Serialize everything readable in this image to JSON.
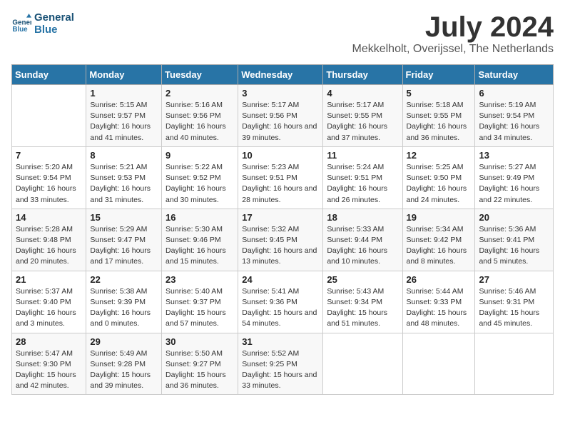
{
  "logo": {
    "text_general": "General",
    "text_blue": "Blue"
  },
  "title": "July 2024",
  "location": "Mekkelholt, Overijssel, The Netherlands",
  "headers": [
    "Sunday",
    "Monday",
    "Tuesday",
    "Wednesday",
    "Thursday",
    "Friday",
    "Saturday"
  ],
  "weeks": [
    [
      {
        "day": "",
        "sunrise": "",
        "sunset": "",
        "daylight": ""
      },
      {
        "day": "1",
        "sunrise": "Sunrise: 5:15 AM",
        "sunset": "Sunset: 9:57 PM",
        "daylight": "Daylight: 16 hours and 41 minutes."
      },
      {
        "day": "2",
        "sunrise": "Sunrise: 5:16 AM",
        "sunset": "Sunset: 9:56 PM",
        "daylight": "Daylight: 16 hours and 40 minutes."
      },
      {
        "day": "3",
        "sunrise": "Sunrise: 5:17 AM",
        "sunset": "Sunset: 9:56 PM",
        "daylight": "Daylight: 16 hours and 39 minutes."
      },
      {
        "day": "4",
        "sunrise": "Sunrise: 5:17 AM",
        "sunset": "Sunset: 9:55 PM",
        "daylight": "Daylight: 16 hours and 37 minutes."
      },
      {
        "day": "5",
        "sunrise": "Sunrise: 5:18 AM",
        "sunset": "Sunset: 9:55 PM",
        "daylight": "Daylight: 16 hours and 36 minutes."
      },
      {
        "day": "6",
        "sunrise": "Sunrise: 5:19 AM",
        "sunset": "Sunset: 9:54 PM",
        "daylight": "Daylight: 16 hours and 34 minutes."
      }
    ],
    [
      {
        "day": "7",
        "sunrise": "Sunrise: 5:20 AM",
        "sunset": "Sunset: 9:54 PM",
        "daylight": "Daylight: 16 hours and 33 minutes."
      },
      {
        "day": "8",
        "sunrise": "Sunrise: 5:21 AM",
        "sunset": "Sunset: 9:53 PM",
        "daylight": "Daylight: 16 hours and 31 minutes."
      },
      {
        "day": "9",
        "sunrise": "Sunrise: 5:22 AM",
        "sunset": "Sunset: 9:52 PM",
        "daylight": "Daylight: 16 hours and 30 minutes."
      },
      {
        "day": "10",
        "sunrise": "Sunrise: 5:23 AM",
        "sunset": "Sunset: 9:51 PM",
        "daylight": "Daylight: 16 hours and 28 minutes."
      },
      {
        "day": "11",
        "sunrise": "Sunrise: 5:24 AM",
        "sunset": "Sunset: 9:51 PM",
        "daylight": "Daylight: 16 hours and 26 minutes."
      },
      {
        "day": "12",
        "sunrise": "Sunrise: 5:25 AM",
        "sunset": "Sunset: 9:50 PM",
        "daylight": "Daylight: 16 hours and 24 minutes."
      },
      {
        "day": "13",
        "sunrise": "Sunrise: 5:27 AM",
        "sunset": "Sunset: 9:49 PM",
        "daylight": "Daylight: 16 hours and 22 minutes."
      }
    ],
    [
      {
        "day": "14",
        "sunrise": "Sunrise: 5:28 AM",
        "sunset": "Sunset: 9:48 PM",
        "daylight": "Daylight: 16 hours and 20 minutes."
      },
      {
        "day": "15",
        "sunrise": "Sunrise: 5:29 AM",
        "sunset": "Sunset: 9:47 PM",
        "daylight": "Daylight: 16 hours and 17 minutes."
      },
      {
        "day": "16",
        "sunrise": "Sunrise: 5:30 AM",
        "sunset": "Sunset: 9:46 PM",
        "daylight": "Daylight: 16 hours and 15 minutes."
      },
      {
        "day": "17",
        "sunrise": "Sunrise: 5:32 AM",
        "sunset": "Sunset: 9:45 PM",
        "daylight": "Daylight: 16 hours and 13 minutes."
      },
      {
        "day": "18",
        "sunrise": "Sunrise: 5:33 AM",
        "sunset": "Sunset: 9:44 PM",
        "daylight": "Daylight: 16 hours and 10 minutes."
      },
      {
        "day": "19",
        "sunrise": "Sunrise: 5:34 AM",
        "sunset": "Sunset: 9:42 PM",
        "daylight": "Daylight: 16 hours and 8 minutes."
      },
      {
        "day": "20",
        "sunrise": "Sunrise: 5:36 AM",
        "sunset": "Sunset: 9:41 PM",
        "daylight": "Daylight: 16 hours and 5 minutes."
      }
    ],
    [
      {
        "day": "21",
        "sunrise": "Sunrise: 5:37 AM",
        "sunset": "Sunset: 9:40 PM",
        "daylight": "Daylight: 16 hours and 3 minutes."
      },
      {
        "day": "22",
        "sunrise": "Sunrise: 5:38 AM",
        "sunset": "Sunset: 9:39 PM",
        "daylight": "Daylight: 16 hours and 0 minutes."
      },
      {
        "day": "23",
        "sunrise": "Sunrise: 5:40 AM",
        "sunset": "Sunset: 9:37 PM",
        "daylight": "Daylight: 15 hours and 57 minutes."
      },
      {
        "day": "24",
        "sunrise": "Sunrise: 5:41 AM",
        "sunset": "Sunset: 9:36 PM",
        "daylight": "Daylight: 15 hours and 54 minutes."
      },
      {
        "day": "25",
        "sunrise": "Sunrise: 5:43 AM",
        "sunset": "Sunset: 9:34 PM",
        "daylight": "Daylight: 15 hours and 51 minutes."
      },
      {
        "day": "26",
        "sunrise": "Sunrise: 5:44 AM",
        "sunset": "Sunset: 9:33 PM",
        "daylight": "Daylight: 15 hours and 48 minutes."
      },
      {
        "day": "27",
        "sunrise": "Sunrise: 5:46 AM",
        "sunset": "Sunset: 9:31 PM",
        "daylight": "Daylight: 15 hours and 45 minutes."
      }
    ],
    [
      {
        "day": "28",
        "sunrise": "Sunrise: 5:47 AM",
        "sunset": "Sunset: 9:30 PM",
        "daylight": "Daylight: 15 hours and 42 minutes."
      },
      {
        "day": "29",
        "sunrise": "Sunrise: 5:49 AM",
        "sunset": "Sunset: 9:28 PM",
        "daylight": "Daylight: 15 hours and 39 minutes."
      },
      {
        "day": "30",
        "sunrise": "Sunrise: 5:50 AM",
        "sunset": "Sunset: 9:27 PM",
        "daylight": "Daylight: 15 hours and 36 minutes."
      },
      {
        "day": "31",
        "sunrise": "Sunrise: 5:52 AM",
        "sunset": "Sunset: 9:25 PM",
        "daylight": "Daylight: 15 hours and 33 minutes."
      },
      {
        "day": "",
        "sunrise": "",
        "sunset": "",
        "daylight": ""
      },
      {
        "day": "",
        "sunrise": "",
        "sunset": "",
        "daylight": ""
      },
      {
        "day": "",
        "sunrise": "",
        "sunset": "",
        "daylight": ""
      }
    ]
  ]
}
